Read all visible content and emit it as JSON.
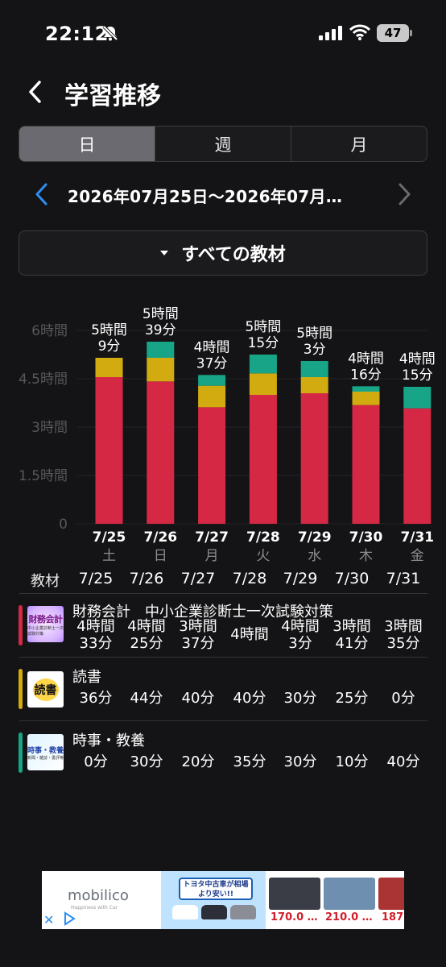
{
  "status": {
    "time": "22:12",
    "battery": "47"
  },
  "header": {
    "title": "学習推移"
  },
  "segments": [
    {
      "label": "日",
      "active": true
    },
    {
      "label": "週",
      "active": false
    },
    {
      "label": "月",
      "active": false
    }
  ],
  "date_range": "2026年07月25日〜2026年07月…",
  "filter": {
    "label": "すべての教材"
  },
  "colors": {
    "zaimu": "#d52845",
    "dokusho": "#d1ab0f",
    "jiji": "#18a587",
    "background": "#141416"
  },
  "chart_data": {
    "type": "bar",
    "stacked": true,
    "categories": [
      "7/25",
      "7/26",
      "7/27",
      "7/28",
      "7/29",
      "7/30",
      "7/31"
    ],
    "weekdays": [
      "土",
      "日",
      "月",
      "火",
      "水",
      "木",
      "金"
    ],
    "y_ticks": [
      "0",
      "1.5時間",
      "3時間",
      "4.5時間",
      "6時間"
    ],
    "ylim_minutes": [
      0,
      360
    ],
    "series": [
      {
        "name": "財務会計　中小企業診断士一次試験対策",
        "color": "#d52845",
        "values_minutes": [
          273,
          265,
          217,
          240,
          243,
          221,
          215
        ]
      },
      {
        "name": "読書",
        "color": "#d1ab0f",
        "values_minutes": [
          36,
          44,
          40,
          40,
          30,
          25,
          0
        ]
      },
      {
        "name": "時事・教養",
        "color": "#18a587",
        "values_minutes": [
          0,
          30,
          20,
          35,
          30,
          10,
          40
        ]
      }
    ],
    "totals": [
      [
        "5時間",
        "9分"
      ],
      [
        "5時間",
        "39分"
      ],
      [
        "4時間",
        "37分"
      ],
      [
        "5時間",
        "15分"
      ],
      [
        "5時間",
        "3分"
      ],
      [
        "4時間",
        "16分"
      ],
      [
        "4時間",
        "15分"
      ]
    ]
  },
  "table": {
    "header_label": "教材",
    "dates": [
      "7/25",
      "7/26",
      "7/27",
      "7/28",
      "7/29",
      "7/30",
      "7/31"
    ],
    "materials": [
      {
        "name": "財務会計　中小企業診断士一次試験対策",
        "thumb_title": "財務会計",
        "thumb_sub": "中小企業診断士一次試験対策",
        "values": [
          [
            "4時間",
            "33分"
          ],
          [
            "4時間",
            "25分"
          ],
          [
            "3時間",
            "37分"
          ],
          [
            "4時間",
            ""
          ],
          [
            "4時間",
            "3分"
          ],
          [
            "3時間",
            "41分"
          ],
          [
            "3時間",
            "35分"
          ]
        ]
      },
      {
        "name": "読書",
        "thumb_title": "読書",
        "values": [
          "36分",
          "44分",
          "40分",
          "40分",
          "30分",
          "25分",
          "0分"
        ]
      },
      {
        "name": "時事・教養",
        "thumb_title": "時事・教養",
        "thumb_sub": "新聞・雑誌・書評等",
        "values": [
          "0分",
          "30分",
          "20分",
          "35分",
          "30分",
          "10分",
          "40分"
        ]
      }
    ]
  },
  "ad": {
    "logo": "mobilico",
    "tagline": "Happiness with Car",
    "headline": "トヨタ中古車が相場より安い!!",
    "prices": [
      "170.0 …",
      "210.0 …",
      "187"
    ]
  }
}
